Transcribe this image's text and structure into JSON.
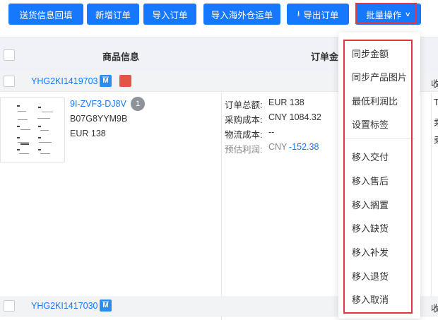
{
  "toolbar": {
    "buttons": [
      "送货信息回填",
      "新增订单",
      "导入订单",
      "导入海外仓运单",
      "导出订单",
      "批量操作"
    ]
  },
  "table": {
    "headers": {
      "product_info": "商品信息",
      "order_amount": "订单金额"
    }
  },
  "orders": [
    {
      "id": "YHG2KI1419703",
      "platform_badge": "M",
      "right_partial": "收",
      "product": {
        "sku": "9I-ZVF3-DJ8V",
        "asin": "B07G8YYM9B",
        "price": "EUR 138",
        "quantity": "1"
      },
      "amounts": {
        "total_label": "订单总额:",
        "total_value": "EUR 138",
        "purchase_label": "采购成本:",
        "purchase_value": "CNY 1084.32",
        "logistics_label": "物流成本:",
        "logistics_value": "--",
        "profit_label": "预估利润:",
        "profit_currency": "CNY",
        "profit_value": "-152.38"
      },
      "right_lines": [
        "T",
        "乘",
        "乘"
      ]
    },
    {
      "id": "YHG2KI1417030",
      "platform_badge": "M",
      "right_partial": "收"
    }
  ],
  "dropdown": {
    "group1": [
      "同步金额",
      "同步产品图片",
      "最低利润比",
      "设置标签"
    ],
    "group2": [
      "移入交付",
      "移入售后",
      "移入搁置",
      "移入缺货",
      "移入补发",
      "移入退货",
      "移入取消"
    ]
  },
  "icons": {
    "download": "download-icon",
    "chevron": "chevron-down-icon"
  },
  "colors": {
    "primary": "#1677ff",
    "highlight": "#e2393c",
    "profit_negative": "#1677ff"
  }
}
